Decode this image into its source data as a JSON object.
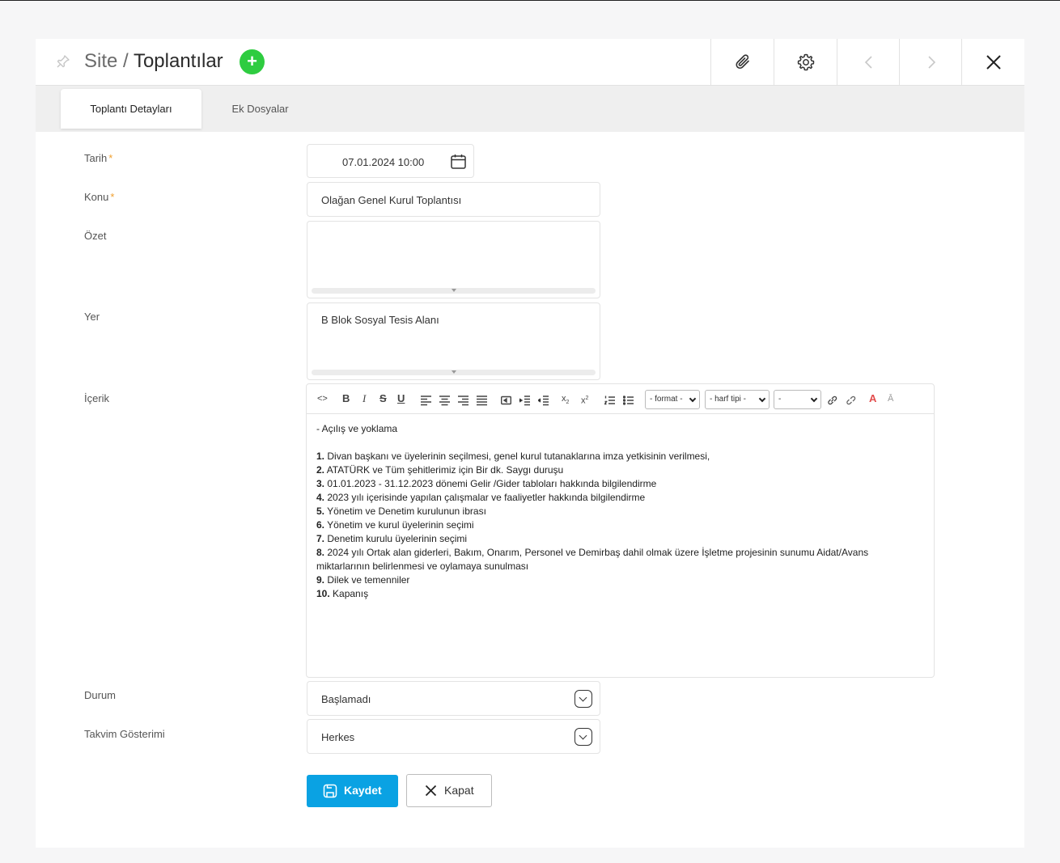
{
  "header": {
    "title_prefix": "Site",
    "title_separator": " / ",
    "title_main": "Toplantılar",
    "add_symbol": "+",
    "icons": [
      "pin-icon",
      "plus-icon",
      "paperclip-icon",
      "gear-icon",
      "chevron-left-icon",
      "chevron-right-icon",
      "close-icon"
    ]
  },
  "tabs": [
    {
      "label": "Toplantı Detayları",
      "active": true
    },
    {
      "label": "Ek Dosyalar",
      "active": false
    }
  ],
  "form": {
    "tarih": {
      "label": "Tarih",
      "required": "*",
      "value": "07.01.2024 10:00"
    },
    "konu": {
      "label": "Konu",
      "required": "*",
      "value": "Olağan Genel Kurul Toplantısı"
    },
    "ozet": {
      "label": "Özet",
      "value": ""
    },
    "yer": {
      "label": "Yer",
      "value": "B Blok Sosyal Tesis Alanı"
    },
    "icerik": {
      "label": "İçerik",
      "toolbar": {
        "format_select": "- format -",
        "font_select": "- harf tipi -",
        "size_select": "-"
      },
      "intro": "- Açılış ve yoklama",
      "items": [
        {
          "num": "1.",
          "text": "Divan başkanı ve üyelerinin seçilmesi, genel kurul tutanaklarına imza yetkisinin verilmesi,"
        },
        {
          "num": "2.",
          "text": "ATATÜRK ve Tüm şehitlerimiz için Bir dk. Saygı duruşu"
        },
        {
          "num": "3.",
          "text": "01.01.2023 - 31.12.2023 dönemi Gelir /Gider tabloları hakkında bilgilendirme"
        },
        {
          "num": "4.",
          "text": "2023 yılı içerisinde yapılan çalışmalar ve faaliyetler hakkında bilgilendirme"
        },
        {
          "num": "5.",
          "text": "Yönetim ve Denetim kurulunun ibrası"
        },
        {
          "num": "6.",
          "text": "Yönetim ve kurul üyelerinin seçimi"
        },
        {
          "num": "7.",
          "text": "Denetim kurulu üyelerinin seçimi"
        },
        {
          "num": "8.",
          "text": "2024 yılı Ortak alan giderleri, Bakım, Onarım, Personel ve Demirbaş dahil olmak üzere İşletme projesinin sunumu Aidat/Avans",
          "cont": "miktarlarının belirlenmesi ve oylamaya sunulması"
        },
        {
          "num": "9.",
          "text": "Dilek ve temenniler"
        },
        {
          "num": "10.",
          "text": "Kapanış"
        }
      ]
    },
    "durum": {
      "label": "Durum",
      "value": "Başlamadı"
    },
    "takvim": {
      "label": "Takvim Gösterimi",
      "value": "Herkes"
    }
  },
  "actions": {
    "save_label": "Kaydet",
    "close_label": "Kapat"
  },
  "colors": {
    "accent": "#0aa2e3",
    "add": "#2ecc40",
    "required": "#f0a030"
  }
}
